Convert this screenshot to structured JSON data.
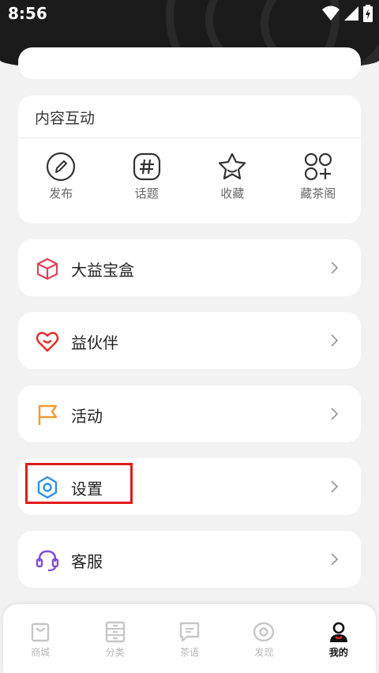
{
  "status_bar": {
    "time": "8:56"
  },
  "interaction": {
    "title": "内容互动",
    "items": [
      {
        "label": "发布",
        "icon": "pencil-circle-icon"
      },
      {
        "label": "话题",
        "icon": "hashtag-icon"
      },
      {
        "label": "收藏",
        "icon": "star-icon"
      },
      {
        "label": "藏茶阁",
        "icon": "circles-plus-icon"
      }
    ]
  },
  "menu": [
    {
      "label": "大益宝盒",
      "icon": "box-icon",
      "color": "#e0415a"
    },
    {
      "label": "益伙伴",
      "icon": "heart-smile-icon",
      "color": "#e52a2a"
    },
    {
      "label": "活动",
      "icon": "flag-icon",
      "color": "#f29a2e"
    },
    {
      "label": "设置",
      "icon": "hexagon-settings-icon",
      "color": "#2f8fe4"
    },
    {
      "label": "客服",
      "icon": "headset-icon",
      "color": "#7b4fd6"
    }
  ],
  "tabs": [
    {
      "label": "商城",
      "icon": "bag-icon"
    },
    {
      "label": "分类",
      "icon": "category-icon"
    },
    {
      "label": "茶语",
      "icon": "chat-icon"
    },
    {
      "label": "发现",
      "icon": "eye-icon"
    },
    {
      "label": "我的",
      "icon": "user-icon",
      "active": true
    }
  ]
}
